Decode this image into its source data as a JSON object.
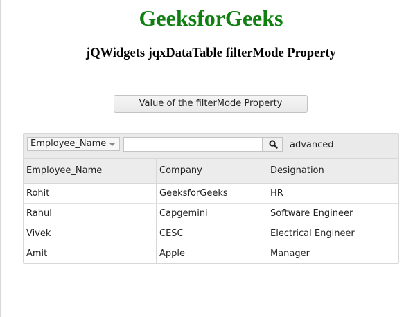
{
  "header": {
    "title": "GeeksforGeeks",
    "title_color": "#0f7f12",
    "subtitle": "jQWidgets jqxDataTable filterMode Property"
  },
  "action_button": {
    "label": "Value of the filterMode Property"
  },
  "filter": {
    "column_select": "Employee_Name",
    "search_value": "",
    "search_icon": "search-icon",
    "advanced_label": "advanced"
  },
  "table": {
    "columns": [
      "Employee_Name",
      "Company",
      "Designation"
    ],
    "rows": [
      [
        "Rohit",
        "GeeksforGeeks",
        "HR"
      ],
      [
        "Rahul",
        "Capgemini",
        "Software Engineer"
      ],
      [
        "Vivek",
        "CESC",
        "Electrical Engineer"
      ],
      [
        "Amit",
        "Apple",
        "Manager"
      ]
    ]
  }
}
